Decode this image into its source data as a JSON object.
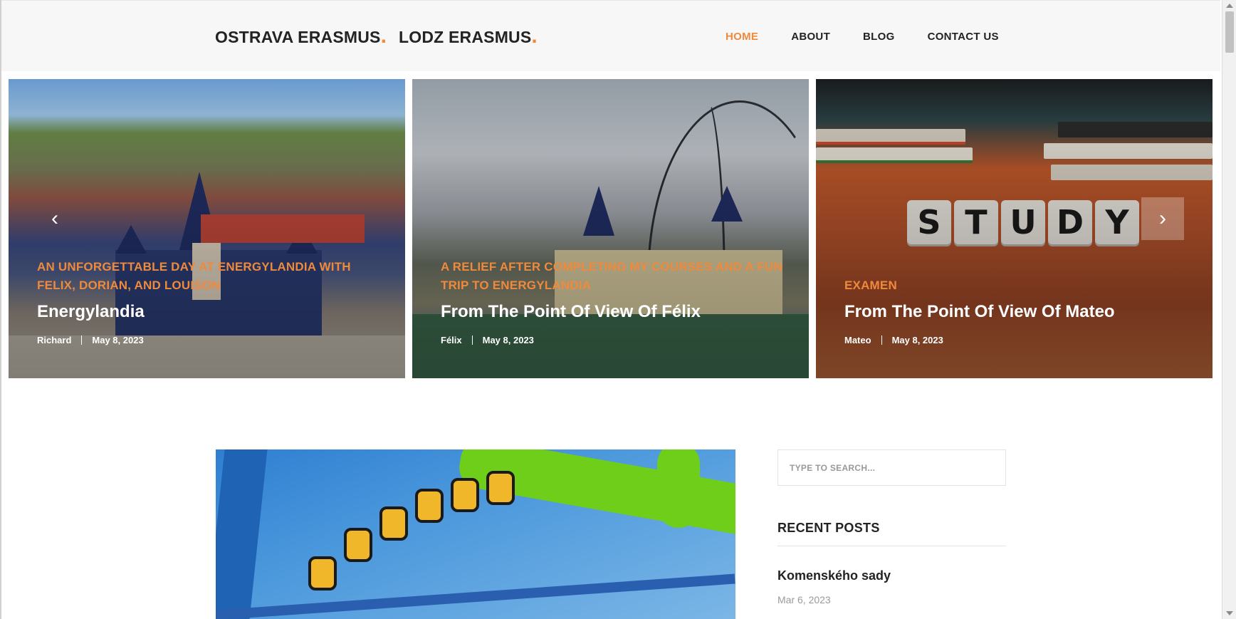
{
  "header": {
    "logos": [
      {
        "text": "OSTRAVA ERASMUS",
        "dot": "."
      },
      {
        "text": "LODZ ERASMUS",
        "dot": "."
      }
    ],
    "nav": [
      {
        "label": "HOME",
        "active": true
      },
      {
        "label": "ABOUT",
        "active": false
      },
      {
        "label": "BLOG",
        "active": false
      },
      {
        "label": "CONTACT US",
        "active": false
      }
    ]
  },
  "slider": {
    "prev_icon": "chevron-left-icon",
    "next_icon": "chevron-right-icon",
    "prev_glyph": "‹",
    "next_glyph": "›",
    "slides": [
      {
        "category": "AN UNFORGETTABLE DAY AT ENERGYLANDIA WITH FELIX, DORIAN, AND LOUISON",
        "title": "Energylandia",
        "author": "Richard",
        "date": "May 8, 2023"
      },
      {
        "category": "A RELIEF AFTER COMPLETING MY COURSES AND A FUN TRIP TO ENERGYLANDIA",
        "title": "From The Point Of View Of Félix",
        "author": "Félix",
        "date": "May 8, 2023"
      },
      {
        "category": "EXAMEN",
        "title": "From The Point Of View Of Mateo",
        "author": "Mateo",
        "date": "May 8, 2023",
        "image_text": [
          "S",
          "T",
          "U",
          "D",
          "Y"
        ]
      }
    ]
  },
  "sidebar": {
    "search_placeholder": "TYPE TO SEARCH...",
    "recent_heading": "RECENT POSTS",
    "recent_posts": [
      {
        "title": "Komenského sady",
        "date": "Mar 6, 2023"
      }
    ]
  },
  "colors": {
    "accent": "#ef8a3c",
    "text": "#232323",
    "header_bg": "#f7f7f7"
  }
}
